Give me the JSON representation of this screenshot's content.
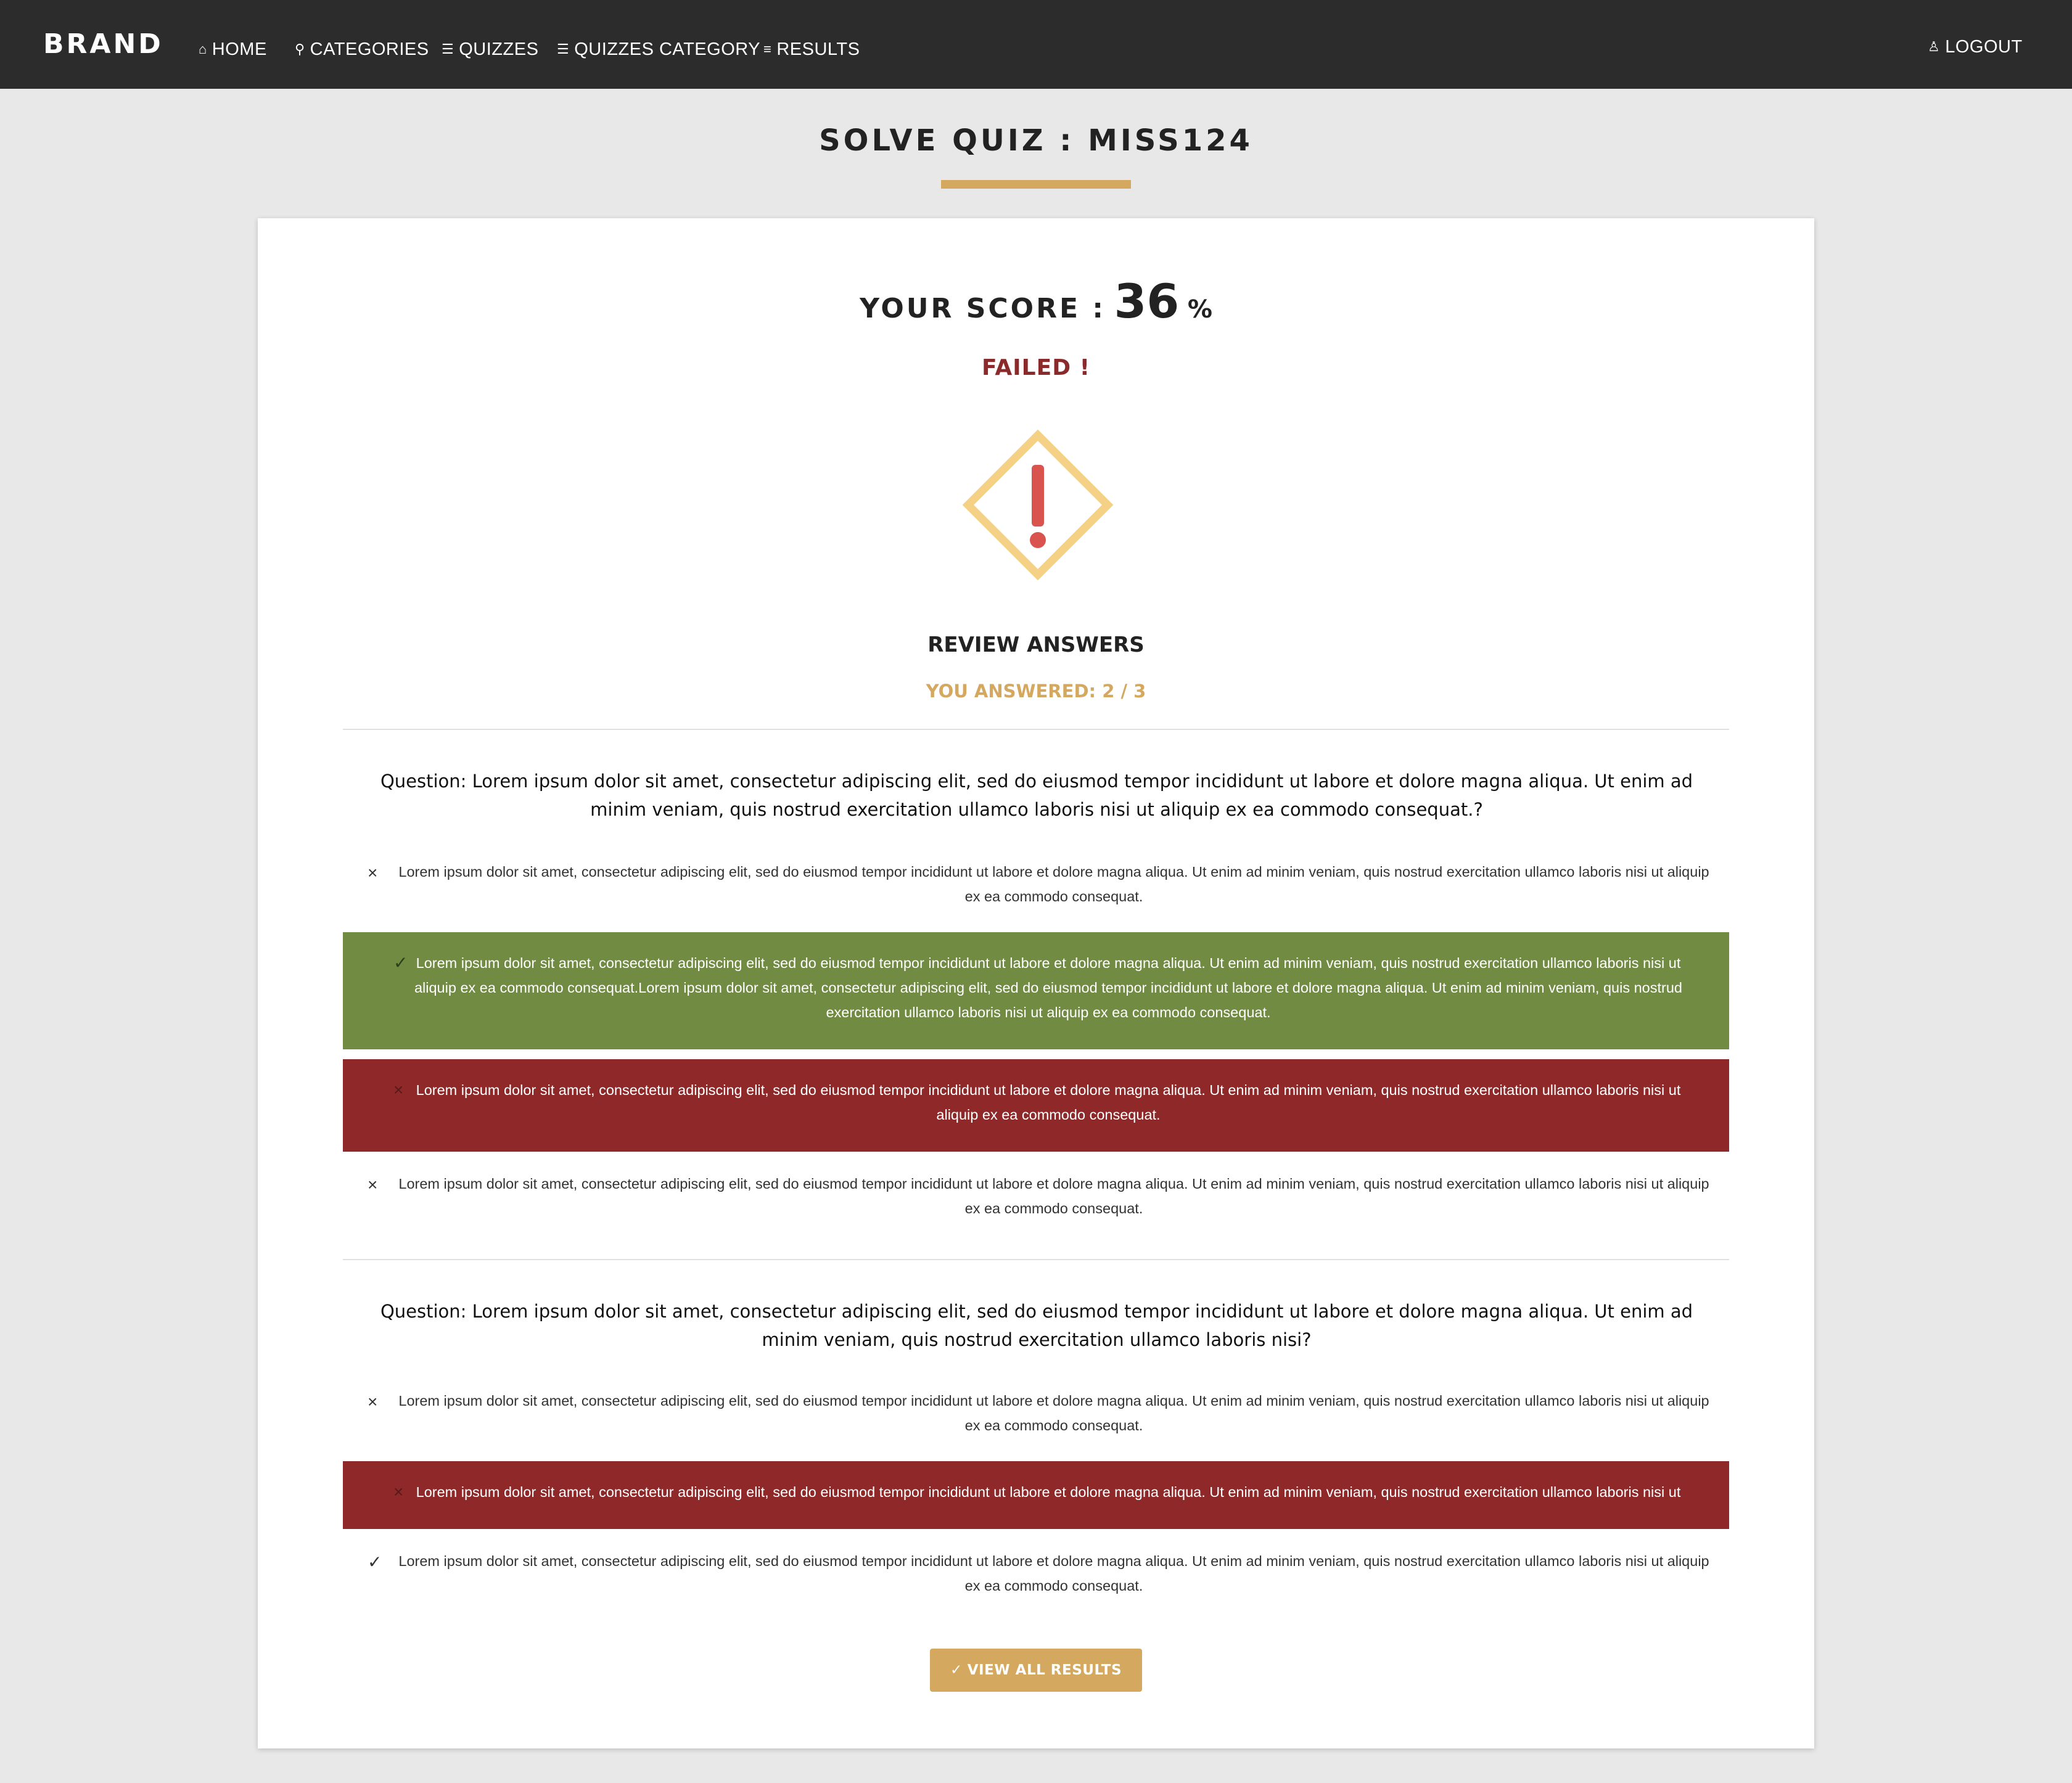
{
  "nav": {
    "brand": "BRAND",
    "home": "HOME",
    "categories": "CATEGORIES",
    "quizzes": "QUIZZES",
    "quizzes_category": "QUIZZES CATEGORY",
    "results": "RESULTS",
    "logout": "LOGOUT",
    "icons": {
      "home": "home-icon",
      "categories": "pin-icon",
      "quizzes": "list-icon",
      "quizzes_category": "list-icon",
      "results": "checklist-icon",
      "logout": "user-icon"
    }
  },
  "page": {
    "title": "SOLVE QUIZ : MISS124",
    "accent_color": "#d4a85f"
  },
  "result": {
    "score_label": "YOUR SCORE :",
    "score_value": "36",
    "score_unit": "%",
    "status": "FAILED !",
    "status_color": "#8b2a2a",
    "status_icon": "warning-diamond-icon",
    "review_title": "REVIEW ANSWERS",
    "answered": "YOU ANSWERED: 2 / 3"
  },
  "questions": [
    {
      "text": "Question: Lorem ipsum dolor sit amet, consectetur adipiscing elit, sed do eiusmod tempor incididunt ut labore et dolore magna aliqua. Ut enim ad minim veniam, quis nostrud exercitation ullamco laboris nisi ut aliquip ex ea commodo consequat.?",
      "answers": [
        {
          "mark": "×",
          "state": "plain",
          "text": "Lorem ipsum dolor sit amet, consectetur adipiscing elit, sed do eiusmod tempor incididunt ut labore et dolore magna aliqua. Ut enim ad minim veniam, quis nostrud exercitation ullamco laboris nisi ut aliquip ex ea commodo consequat."
        },
        {
          "mark": "✓",
          "state": "correct",
          "text": "Lorem ipsum dolor sit amet, consectetur adipiscing elit, sed do eiusmod tempor incididunt ut labore et dolore magna aliqua. Ut enim ad minim veniam, quis nostrud exercitation ullamco laboris nisi ut aliquip ex ea commodo consequat.Lorem ipsum dolor sit amet, consectetur adipiscing elit, sed do eiusmod tempor incididunt ut labore et dolore magna aliqua. Ut enim ad minim veniam, quis nostrud exercitation ullamco laboris nisi ut aliquip ex ea commodo consequat."
        },
        {
          "mark": "×",
          "state": "wrong",
          "text": "Lorem ipsum dolor sit amet, consectetur adipiscing elit, sed do eiusmod tempor incididunt ut labore et dolore magna aliqua. Ut enim ad minim veniam, quis nostrud exercitation ullamco laboris nisi ut aliquip ex ea commodo consequat."
        },
        {
          "mark": "×",
          "state": "plain",
          "text": "Lorem ipsum dolor sit amet, consectetur adipiscing elit, sed do eiusmod tempor incididunt ut labore et dolore magna aliqua. Ut enim ad minim veniam, quis nostrud exercitation ullamco laboris nisi ut aliquip ex ea commodo consequat."
        }
      ]
    },
    {
      "text": "Question: Lorem ipsum dolor sit amet, consectetur adipiscing elit, sed do eiusmod tempor incididunt ut labore et dolore magna aliqua. Ut enim ad minim veniam, quis nostrud exercitation ullamco laboris nisi?",
      "answers": [
        {
          "mark": "×",
          "state": "plain",
          "text": "Lorem ipsum dolor sit amet, consectetur adipiscing elit, sed do eiusmod tempor incididunt ut labore et dolore magna aliqua. Ut enim ad minim veniam, quis nostrud exercitation ullamco laboris nisi ut aliquip ex ea commodo consequat."
        },
        {
          "mark": "×",
          "state": "wrong",
          "text": "Lorem ipsum dolor sit amet, consectetur adipiscing elit, sed do eiusmod tempor incididunt ut labore et dolore magna aliqua. Ut enim ad minim veniam, quis nostrud exercitation ullamco laboris nisi ut"
        },
        {
          "mark": "✓",
          "state": "plain",
          "text": "Lorem ipsum dolor sit amet, consectetur adipiscing elit, sed do eiusmod tempor incididunt ut labore et dolore magna aliqua. Ut enim ad minim veniam, quis nostrud exercitation ullamco laboris nisi ut aliquip ex ea commodo consequat."
        }
      ]
    }
  ],
  "colors": {
    "correct": "#728b43",
    "wrong": "#8f2929",
    "nav_bg": "#2c2c2c",
    "page_bg": "#e8e8e8"
  },
  "actions": {
    "view_all_results": "VIEW ALL RESULTS",
    "view_all_results_icon": "check-icon"
  }
}
